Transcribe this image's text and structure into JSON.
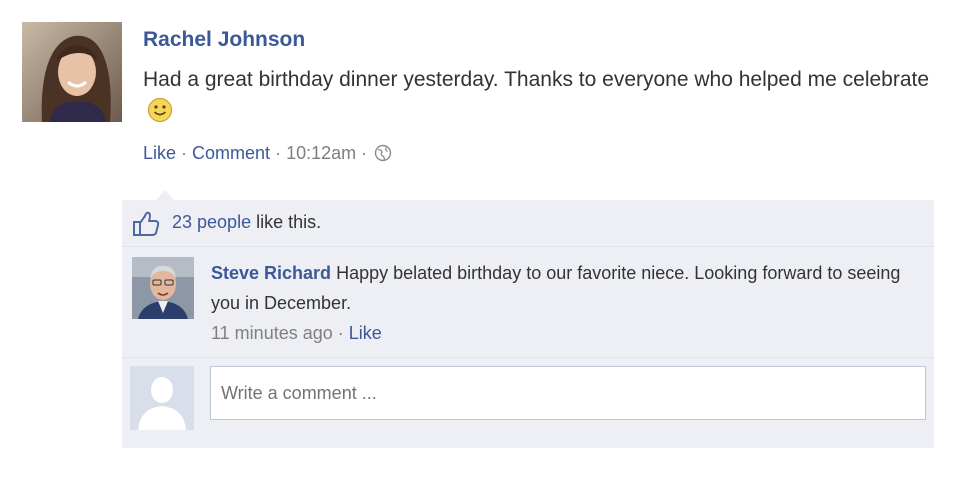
{
  "post": {
    "author": "Rachel Johnson",
    "text": "Had a great birthday dinner yesterday. Thanks to everyone who helped me celebrate",
    "actions": {
      "like": "Like",
      "separator1": " · ",
      "comment": "Comment",
      "separator2": " · ",
      "time": "10:12am",
      "separator3": " · "
    }
  },
  "likes": {
    "count_link": "23 people",
    "suffix": " like this."
  },
  "comment": {
    "author": "Steve Richard",
    "text": " Happy belated birthday to our favorite niece. Looking forward to seeing you in December.",
    "time": "11 minutes ago",
    "separator": " · ",
    "like": "Like"
  },
  "composer": {
    "placeholder": "Write a comment ..."
  },
  "colors": {
    "link": "#3b5998",
    "feedback_bg": "#edeff4",
    "meta_text": "#7f7f7f"
  },
  "icons": [
    "profile-photo",
    "smiley-emoji-icon",
    "globe-icon",
    "thumbs-up-icon",
    "default-avatar-icon"
  ]
}
